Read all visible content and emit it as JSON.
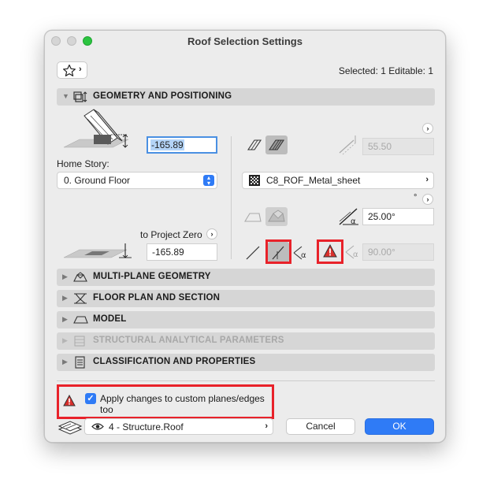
{
  "window": {
    "title": "Roof Selection Settings"
  },
  "header": {
    "selected_info": "Selected: 1 Editable: 1"
  },
  "geometry": {
    "section_label": "GEOMETRY AND POSITIONING",
    "offset_value": "-165.89",
    "home_story_label": "Home Story:",
    "home_story_value": "0. Ground Floor",
    "project_zero_label": "to Project Zero",
    "project_zero_value": "-165.89",
    "pivot_height_value": "55.50",
    "material_value": "C8_ROF_Metal_sheet",
    "degree_symbol": "°",
    "slope_value": "25.00°",
    "edge_angle_value": "90.00°"
  },
  "sections": [
    {
      "label": "MULTI-PLANE GEOMETRY",
      "icon": "multi-plane-icon"
    },
    {
      "label": "FLOOR PLAN AND SECTION",
      "icon": "floor-plan-icon"
    },
    {
      "label": "MODEL",
      "icon": "model-icon"
    },
    {
      "label": "STRUCTURAL ANALYTICAL PARAMETERS",
      "icon": "structural-icon",
      "disabled": true
    },
    {
      "label": "CLASSIFICATION AND PROPERTIES",
      "icon": "classification-icon"
    }
  ],
  "footer": {
    "apply_checkbox_label": "Apply changes to custom planes/edges too",
    "apply_checked": true,
    "layer_value": "4 - Structure.Roof",
    "cancel_label": "Cancel",
    "ok_label": "OK"
  },
  "colors": {
    "accent": "#2f7bf6",
    "highlight_frame": "#e8222a",
    "warning": "#d9302c"
  }
}
